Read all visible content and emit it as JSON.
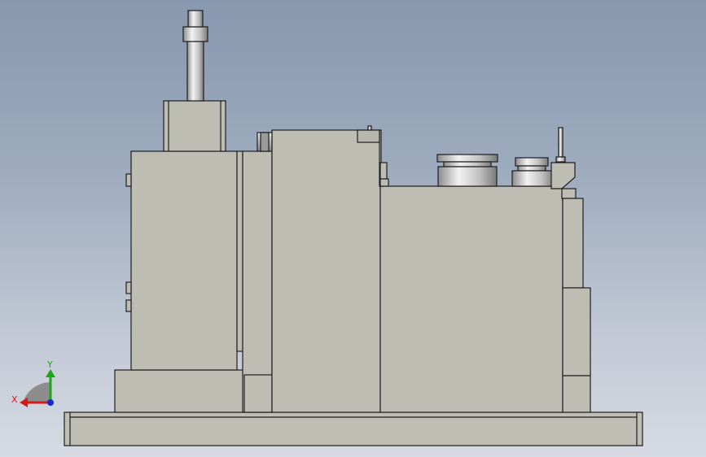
{
  "view": {
    "background_top": "#8797ae",
    "background_bottom": "#d6dbe3",
    "part_color": "#bdbdb4",
    "edge_color": "#1e1e1e",
    "metal_color": "#c7c7c7"
  },
  "triad": {
    "x_label": "X",
    "y_label": "Y",
    "x_color": "#d21a1a",
    "y_color": "#19a619",
    "z_color": "#1a2ad2"
  }
}
